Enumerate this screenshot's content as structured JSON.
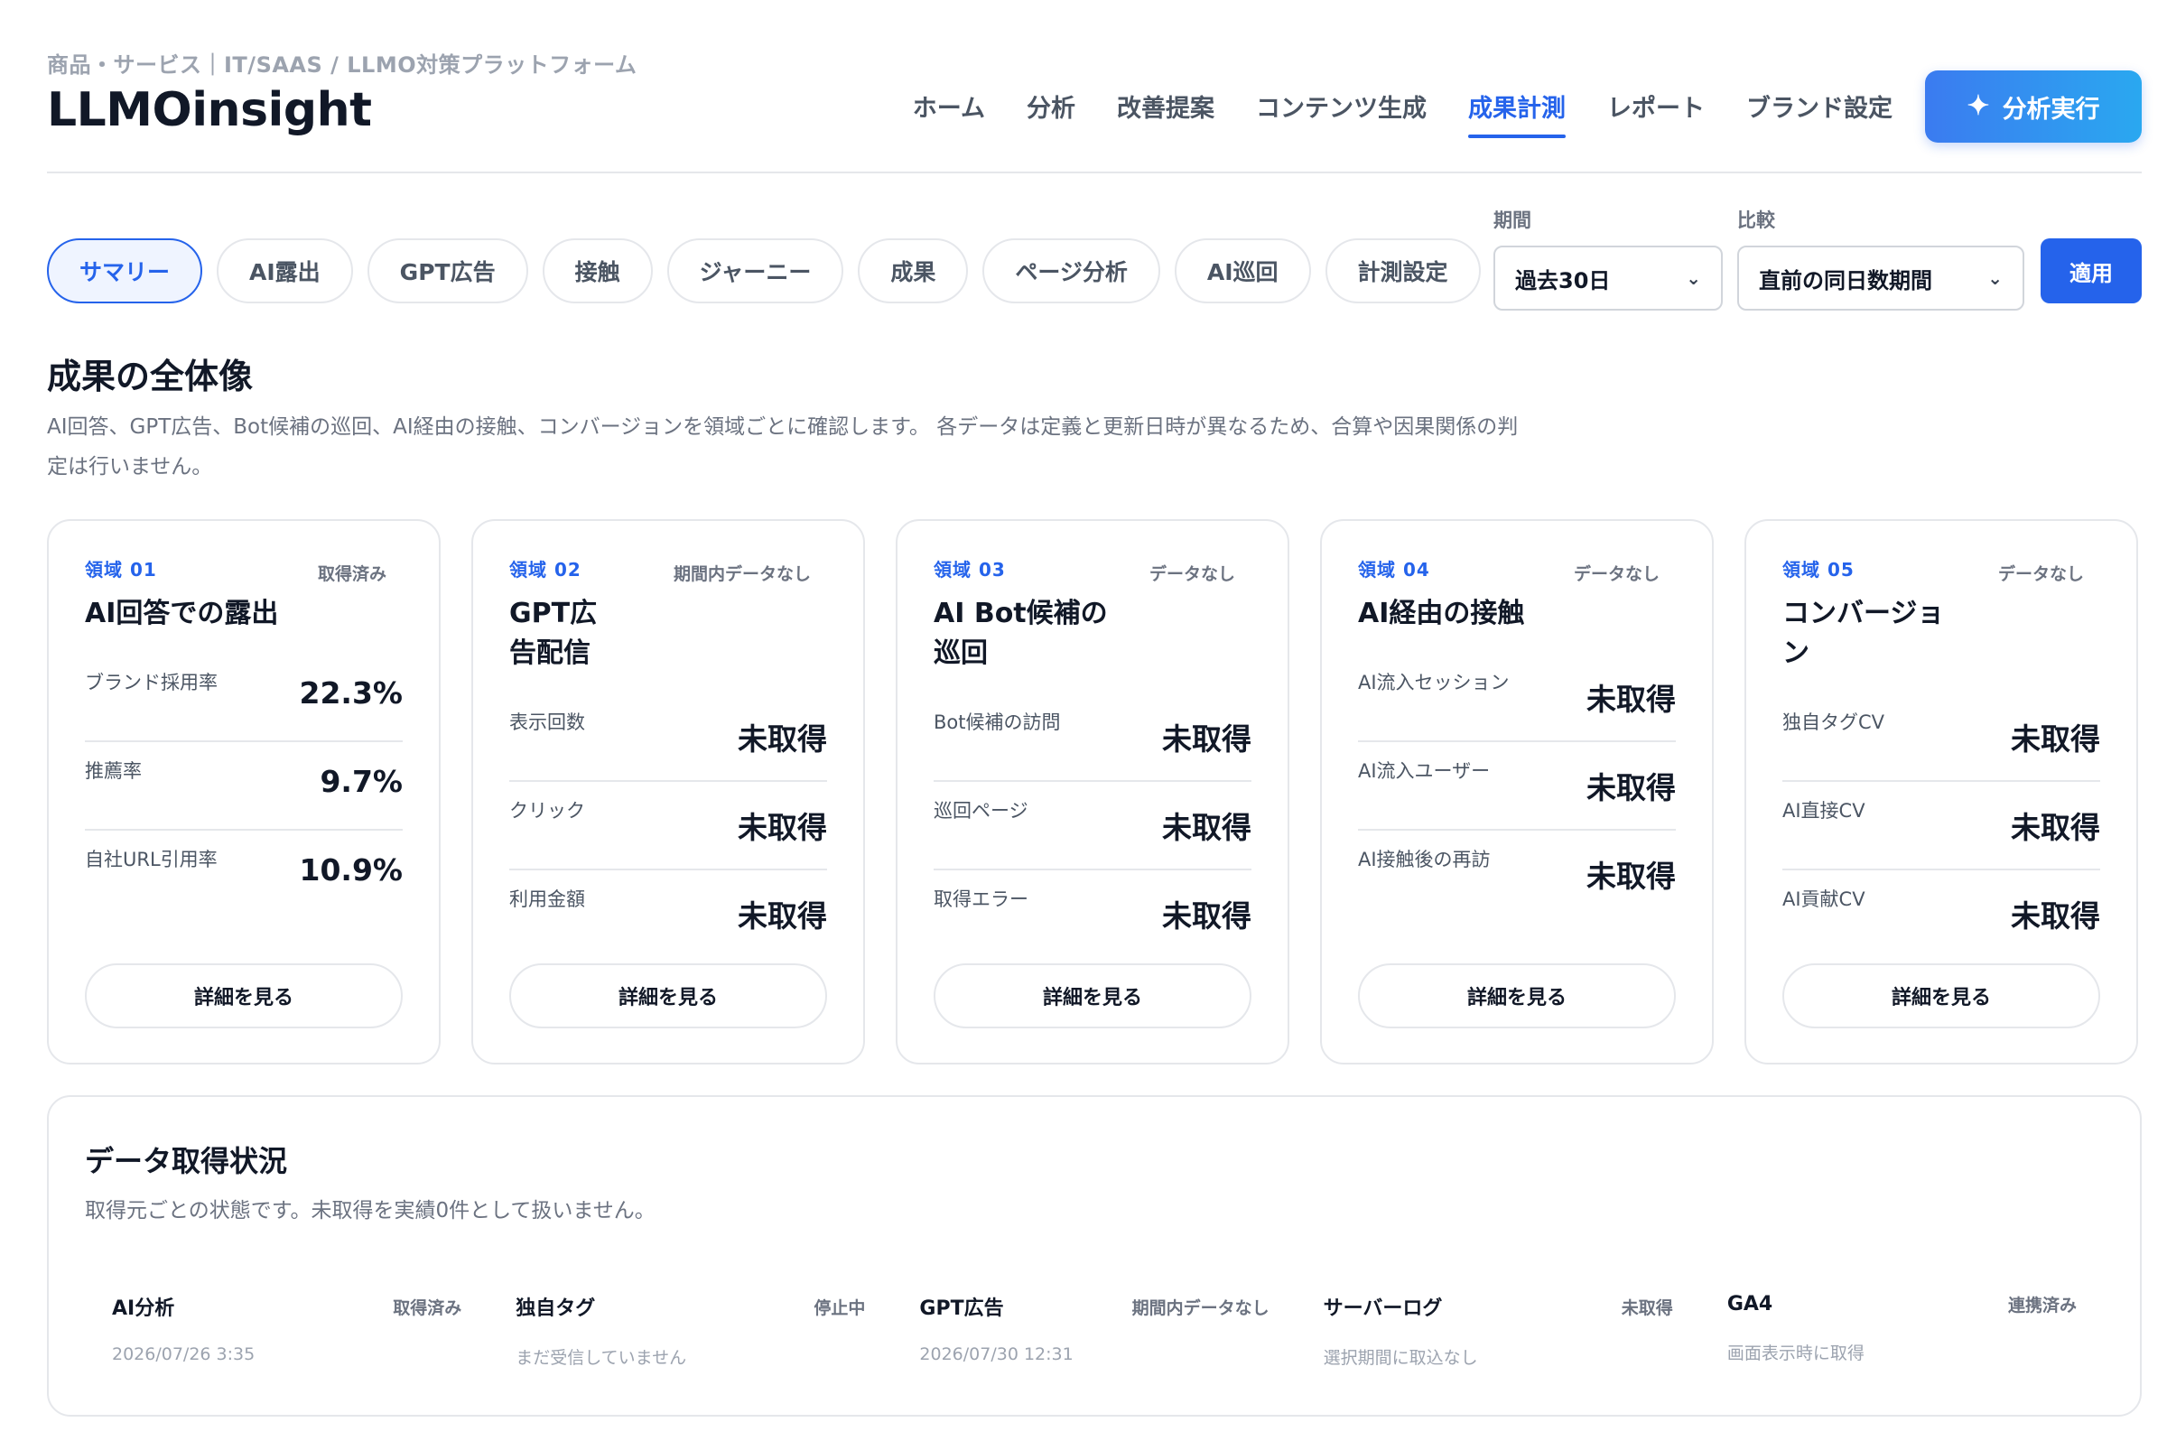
{
  "header": {
    "category": "商品・サービス｜IT/SAAS / LLMO対策プラットフォーム",
    "title": "LLMOinsight",
    "nav": [
      {
        "label": "ホーム"
      },
      {
        "label": "分析"
      },
      {
        "label": "改善提案"
      },
      {
        "label": "コンテンツ生成"
      },
      {
        "label": "成果計測",
        "active": true
      },
      {
        "label": "レポート"
      },
      {
        "label": "ブランド設定"
      }
    ],
    "run_label": "分析実行"
  },
  "toolbar": {
    "tabs": [
      {
        "label": "サマリー",
        "active": true
      },
      {
        "label": "AI露出"
      },
      {
        "label": "GPT広告"
      },
      {
        "label": "接触"
      },
      {
        "label": "ジャーニー"
      },
      {
        "label": "成果"
      },
      {
        "label": "ページ分析"
      },
      {
        "label": "AI巡回"
      },
      {
        "label": "計測設定"
      }
    ],
    "period": {
      "label": "期間",
      "value": "過去30日"
    },
    "compare": {
      "label": "比較",
      "value": "直前の同日数期間"
    },
    "apply_label": "適用"
  },
  "overview": {
    "title": "成果の全体像",
    "description": "AI回答、GPT広告、Bot候補の巡回、AI経由の接触、コンバージョンを領域ごとに確認します。 各データは定義と更新日時が異なるため、合算や因果関係の判定は行いません。"
  },
  "cards": [
    {
      "domain": "領域 01",
      "status": "取得済み",
      "title": "AI回答での露出",
      "metrics": [
        {
          "label": "ブランド採用率",
          "value": "22.3%"
        },
        {
          "label": "推薦率",
          "value": "9.7%"
        },
        {
          "label": "自社URL引用率",
          "value": "10.9%"
        }
      ],
      "button": "詳細を見る"
    },
    {
      "domain": "領域 02",
      "status": "期間内データなし",
      "title": "GPT広告配信",
      "metrics": [
        {
          "label": "表示回数",
          "value": "未取得"
        },
        {
          "label": "クリック",
          "value": "未取得"
        },
        {
          "label": "利用金額",
          "value": "未取得"
        }
      ],
      "button": "詳細を見る"
    },
    {
      "domain": "領域 03",
      "status": "データなし",
      "title": "AI Bot候補の巡回",
      "metrics": [
        {
          "label": "Bot候補の訪問",
          "value": "未取得"
        },
        {
          "label": "巡回ページ",
          "value": "未取得"
        },
        {
          "label": "取得エラー",
          "value": "未取得"
        }
      ],
      "button": "詳細を見る"
    },
    {
      "domain": "領域 04",
      "status": "データなし",
      "title": "AI経由の接触",
      "metrics": [
        {
          "label": "AI流入セッション",
          "value": "未取得"
        },
        {
          "label": "AI流入ユーザー",
          "value": "未取得"
        },
        {
          "label": "AI接触後の再訪",
          "value": "未取得"
        }
      ],
      "button": "詳細を見る"
    },
    {
      "domain": "領域 05",
      "status": "データなし",
      "title": "コンバージョン",
      "metrics": [
        {
          "label": "独自タグCV",
          "value": "未取得"
        },
        {
          "label": "AI直接CV",
          "value": "未取得"
        },
        {
          "label": "AI貢献CV",
          "value": "未取得"
        }
      ],
      "button": "詳細を見る"
    }
  ],
  "data_status": {
    "title": "データ取得状況",
    "description": "取得元ごとの状態です。未取得を実績0件として扱いません。",
    "sources": [
      {
        "name": "AI分析",
        "status": "取得済み",
        "sub": "2026/07/26 3:35"
      },
      {
        "name": "独自タグ",
        "status": "停止中",
        "sub": "まだ受信していません"
      },
      {
        "name": "GPT広告",
        "status": "期間内データなし",
        "sub": "2026/07/30 12:31"
      },
      {
        "name": "サーバーログ",
        "status": "未取得",
        "sub": "選択期間に取込なし"
      },
      {
        "name": "GA4",
        "status": "連携済み",
        "sub": "画面表示時に取得"
      }
    ]
  }
}
